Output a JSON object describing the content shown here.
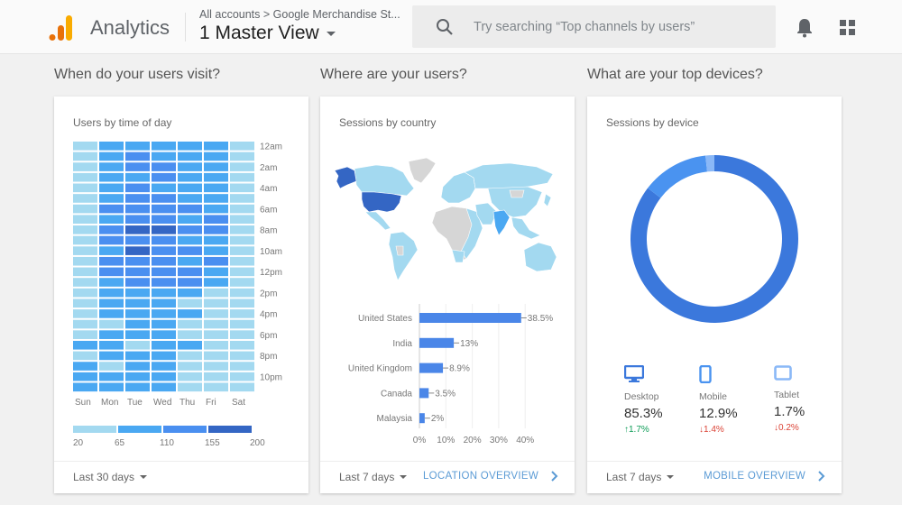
{
  "header": {
    "app_title": "Analytics",
    "breadcrumb": "All accounts > Google Merchandise St...",
    "view_name": "1 Master View",
    "search_placeholder": "Try searching “Top channels by users”",
    "icons": [
      "search-icon",
      "bell-icon",
      "apps-grid-icon"
    ]
  },
  "sections": [
    {
      "heading": "When do your users visit?",
      "card_title": "Users by time of day",
      "date_range": "Last 30 days"
    },
    {
      "heading": "Where are your users?",
      "card_title": "Sessions by country",
      "date_range": "Last 7 days",
      "link_label": "LOCATION OVERVIEW"
    },
    {
      "heading": "What are your top devices?",
      "card_title": "Sessions by device",
      "date_range": "Last 7 days",
      "link_label": "MOBILE OVERVIEW"
    }
  ],
  "colors": {
    "level1": "#a3d9f0",
    "level2": "#4aa8f2",
    "level3": "#4a8ff0",
    "level4": "#3466c4",
    "desktop": "#3b78dc",
    "mobile": "#4a93f0",
    "tablet": "#8ab8f7",
    "up": "#0f9d58",
    "down": "#db4437",
    "link": "#5b9bd5"
  },
  "chart_data": [
    {
      "type": "heatmap",
      "title": "Users by time of day",
      "x": [
        "Sun",
        "Mon",
        "Tue",
        "Wed",
        "Thu",
        "Fri",
        "Sat"
      ],
      "y_tick_labels": [
        "12am",
        "2am",
        "4am",
        "6am",
        "8am",
        "10am",
        "12pm",
        "2pm",
        "4pm",
        "6pm",
        "8pm",
        "10pm"
      ],
      "y_hours": 24,
      "legend_ticks": [
        20,
        65,
        110,
        155,
        200
      ],
      "values": [
        [
          40,
          90,
          90,
          90,
          90,
          90,
          40
        ],
        [
          40,
          90,
          130,
          90,
          90,
          90,
          40
        ],
        [
          40,
          90,
          130,
          130,
          90,
          90,
          40
        ],
        [
          40,
          90,
          90,
          130,
          90,
          90,
          40
        ],
        [
          40,
          90,
          130,
          90,
          90,
          90,
          40
        ],
        [
          40,
          90,
          130,
          130,
          90,
          90,
          40
        ],
        [
          40,
          130,
          130,
          130,
          130,
          90,
          40
        ],
        [
          40,
          90,
          130,
          130,
          90,
          130,
          40
        ],
        [
          40,
          130,
          180,
          180,
          130,
          130,
          40
        ],
        [
          40,
          130,
          130,
          130,
          90,
          90,
          40
        ],
        [
          40,
          90,
          180,
          130,
          130,
          90,
          40
        ],
        [
          40,
          130,
          130,
          130,
          90,
          130,
          40
        ],
        [
          40,
          130,
          130,
          130,
          130,
          90,
          40
        ],
        [
          40,
          90,
          130,
          130,
          130,
          90,
          40
        ],
        [
          40,
          90,
          90,
          90,
          90,
          40,
          40
        ],
        [
          40,
          90,
          90,
          90,
          40,
          40,
          40
        ],
        [
          40,
          90,
          90,
          90,
          90,
          40,
          40
        ],
        [
          40,
          40,
          90,
          90,
          40,
          40,
          40
        ],
        [
          40,
          90,
          90,
          90,
          40,
          40,
          40
        ],
        [
          90,
          90,
          40,
          90,
          90,
          40,
          40
        ],
        [
          40,
          90,
          90,
          90,
          40,
          40,
          40
        ],
        [
          90,
          40,
          90,
          90,
          40,
          40,
          40
        ],
        [
          90,
          90,
          90,
          90,
          40,
          40,
          40
        ],
        [
          90,
          90,
          90,
          90,
          40,
          40,
          40
        ]
      ]
    },
    {
      "type": "bar",
      "orientation": "horizontal",
      "title": "Sessions by country",
      "categories": [
        "United States",
        "India",
        "United Kingdom",
        "Canada",
        "Malaysia"
      ],
      "values": [
        38.5,
        13,
        8.9,
        3.5,
        2
      ],
      "value_labels": [
        "38.5%",
        "13%",
        "8.9%",
        "3.5%",
        "2%"
      ],
      "x_ticks": [
        "0%",
        "10%",
        "20%",
        "30%",
        "40%"
      ],
      "xlim": [
        0,
        40
      ],
      "grid": true,
      "map_highlights": {
        "United States": "level4",
        "India": "level2"
      }
    },
    {
      "type": "pie",
      "donut": true,
      "title": "Sessions by device",
      "categories": [
        "Desktop",
        "Mobile",
        "Tablet"
      ],
      "values": [
        85.3,
        12.9,
        1.7
      ],
      "value_labels": [
        "85.3%",
        "12.9%",
        "1.7%"
      ],
      "deltas": [
        {
          "dir": "up",
          "label": "1.7%"
        },
        {
          "dir": "down",
          "label": "1.4%"
        },
        {
          "dir": "down",
          "label": "0.2%"
        }
      ]
    }
  ]
}
